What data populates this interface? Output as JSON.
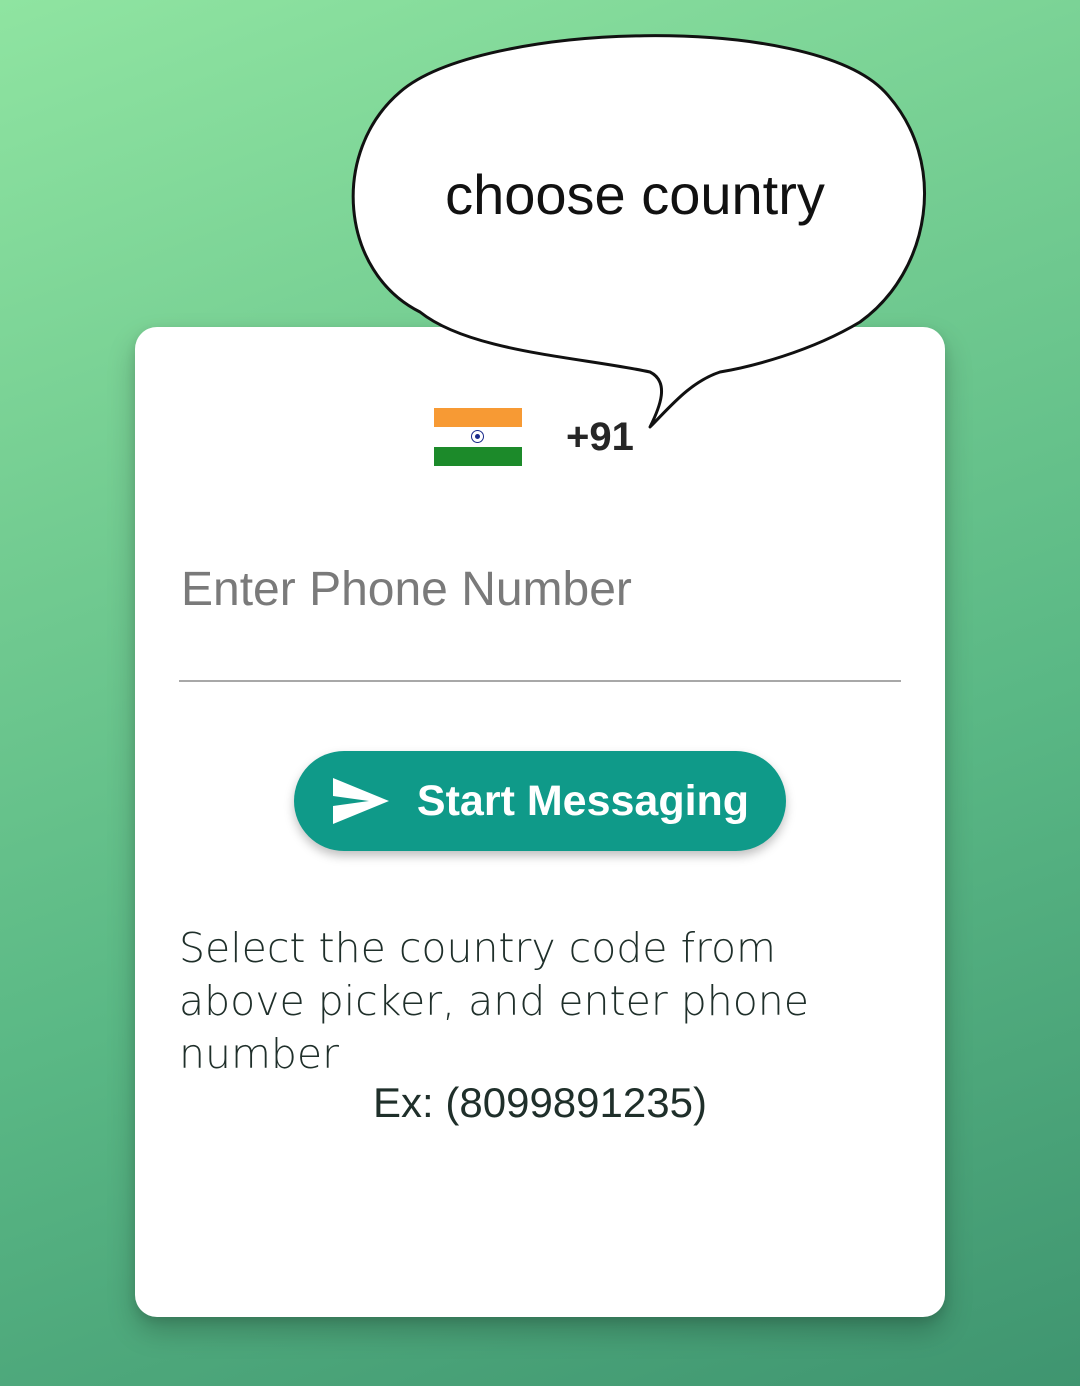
{
  "tooltip": {
    "text": "choose country"
  },
  "country_picker": {
    "flag_icon": "india-flag-icon",
    "code": "+91"
  },
  "phone_input": {
    "placeholder": "Enter Phone Number",
    "value": ""
  },
  "start_button": {
    "icon": "send-icon",
    "label": "Start Messaging"
  },
  "help": {
    "text": "Select the country code from above picker, and enter phone number",
    "example": "Ex: (8099891235)"
  },
  "colors": {
    "background_top": "#8fe4a1",
    "background_bottom": "#3f9570",
    "accent": "#0f9a89",
    "card": "#ffffff"
  }
}
